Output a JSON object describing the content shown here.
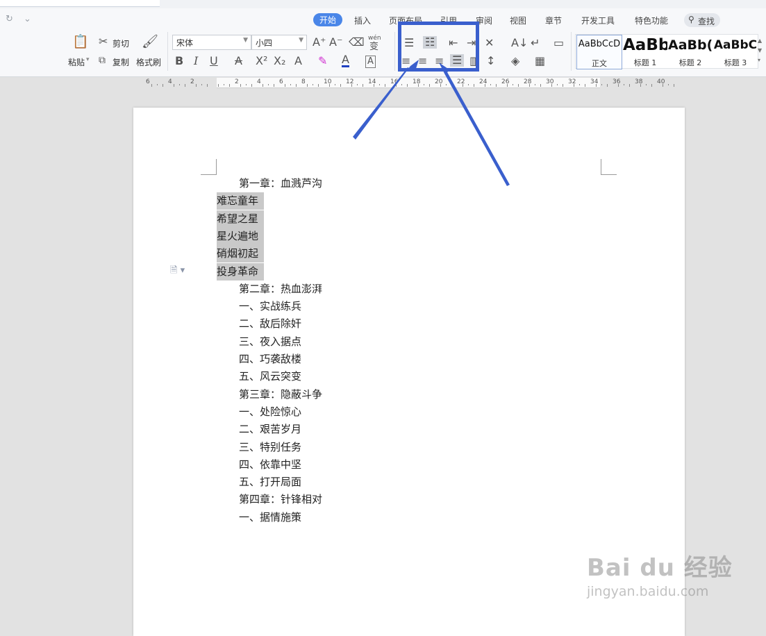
{
  "menu": {
    "tabs": [
      "开始",
      "插入",
      "页面布局",
      "引用",
      "审阅",
      "视图",
      "章节",
      "开发工具",
      "特色功能"
    ],
    "active_tab": "开始",
    "search_label": "查找"
  },
  "toolbar": {
    "paste": "粘贴",
    "cut": "剪切",
    "copy": "复制",
    "format_painter": "格式刷",
    "font_name": "宋体",
    "font_size": "小四",
    "phonetic": "wén"
  },
  "styles": [
    {
      "preview": "AaBbCcD",
      "name": "正文"
    },
    {
      "preview": "AaBb",
      "name": "标题 1"
    },
    {
      "preview": "AaBb(",
      "name": "标题 2"
    },
    {
      "preview": "AaBbC",
      "name": "标题 3"
    }
  ],
  "ruler": {
    "labels": [
      "6",
      "4",
      "2",
      "",
      "2",
      "4",
      "6",
      "8",
      "10",
      "12",
      "14",
      "16",
      "18",
      "20",
      "22",
      "24",
      "26",
      "28",
      "30",
      "32",
      "34",
      "36",
      "38",
      "40"
    ]
  },
  "document": {
    "lines": [
      {
        "text": "第一章：血溅芦沟",
        "indent": true,
        "highlight": false
      },
      {
        "text": "难忘童年",
        "indent": false,
        "highlight": true
      },
      {
        "text": "希望之星",
        "indent": false,
        "highlight": true
      },
      {
        "text": "星火遍地",
        "indent": false,
        "highlight": true
      },
      {
        "text": "硝烟初起",
        "indent": false,
        "highlight": true
      },
      {
        "text": "投身革命",
        "indent": false,
        "highlight": true
      },
      {
        "text": "第二章：热血澎湃",
        "indent": true,
        "highlight": false
      },
      {
        "text": "一、实战练兵",
        "indent": true,
        "highlight": false
      },
      {
        "text": "二、敌后除奸",
        "indent": true,
        "highlight": false
      },
      {
        "text": "三、夜入据点",
        "indent": true,
        "highlight": false
      },
      {
        "text": "四、巧袭敌楼",
        "indent": true,
        "highlight": false
      },
      {
        "text": "五、风云突变",
        "indent": true,
        "highlight": false
      },
      {
        "text": "第三章：隐蔽斗争",
        "indent": true,
        "highlight": false
      },
      {
        "text": "一、处险惊心",
        "indent": true,
        "highlight": false
      },
      {
        "text": "二、艰苦岁月",
        "indent": true,
        "highlight": false
      },
      {
        "text": "三、特别任务",
        "indent": true,
        "highlight": false
      },
      {
        "text": "四、依靠中坚",
        "indent": true,
        "highlight": false
      },
      {
        "text": "五、打开局面",
        "indent": true,
        "highlight": false
      },
      {
        "text": "第四章：针锋相对",
        "indent": true,
        "highlight": false
      },
      {
        "text": "一、据情施策",
        "indent": true,
        "highlight": false
      }
    ]
  },
  "colors": {
    "accent": "#4a86e8",
    "annotation": "#3a5fcd",
    "selection": "#c9c9c9"
  },
  "watermark": {
    "line1": "Bai du 经验",
    "line2": "jingyan.baidu.com"
  }
}
